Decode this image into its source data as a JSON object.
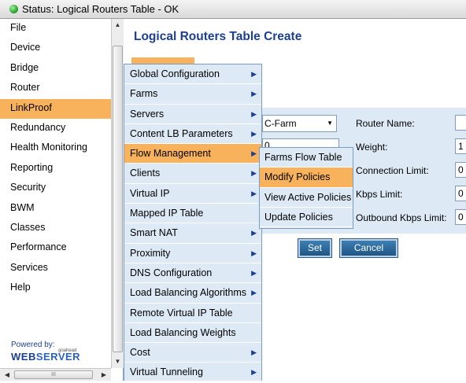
{
  "status": {
    "text": "Status:  Logical Routers Table   -  OK"
  },
  "nav": {
    "items": [
      {
        "label": "File"
      },
      {
        "label": "Device"
      },
      {
        "label": "Bridge"
      },
      {
        "label": "Router"
      },
      {
        "label": "LinkProof",
        "active": true
      },
      {
        "label": "Redundancy"
      },
      {
        "label": "Health Monitoring"
      },
      {
        "label": "Reporting"
      },
      {
        "label": "Security"
      },
      {
        "label": "BWM"
      },
      {
        "label": "Classes"
      },
      {
        "label": "Performance"
      },
      {
        "label": "Services"
      },
      {
        "label": "Help"
      }
    ],
    "powered_by": "Powered by:",
    "brand_small": "goahead",
    "brand_web": "WEB",
    "brand_server": "SERVER"
  },
  "main": {
    "title": "Logical Routers Table Create",
    "farm_select_value": "C-Farm",
    "left_weight_value": "0",
    "fields": {
      "router_name_label": "Router Name:",
      "weight_label": "Weight:",
      "weight_value": "1",
      "connection_limit_label": "Connection Limit:",
      "connection_limit_value": "0",
      "kbps_limit_label": "Kbps Limit:",
      "kbps_limit_value": "0",
      "outbound_kbps_limit_label": "Outbound Kbps Limit:",
      "outbound_kbps_limit_value": "0"
    },
    "set_button": "Set",
    "cancel_button": "Cancel"
  },
  "menu": {
    "items": [
      {
        "label": "Global Configuration",
        "submenu": true
      },
      {
        "label": "Farms",
        "submenu": true
      },
      {
        "label": "Servers",
        "submenu": true
      },
      {
        "label": "Content LB Parameters",
        "submenu": true
      },
      {
        "label": "Flow Management",
        "submenu": true,
        "active": true
      },
      {
        "label": "Clients",
        "submenu": true
      },
      {
        "label": "Virtual IP",
        "submenu": true
      },
      {
        "label": "Mapped IP Table",
        "submenu": false
      },
      {
        "label": "Smart NAT",
        "submenu": true
      },
      {
        "label": "Proximity",
        "submenu": true
      },
      {
        "label": "DNS Configuration",
        "submenu": true
      },
      {
        "label": "Load Balancing Algorithms",
        "submenu": true
      },
      {
        "label": "Remote Virtual IP Table",
        "submenu": false
      },
      {
        "label": "Load Balancing Weights",
        "submenu": false
      },
      {
        "label": "Cost",
        "submenu": true
      },
      {
        "label": "Virtual Tunneling",
        "submenu": true
      }
    ]
  },
  "submenu": {
    "items": [
      {
        "label": "Farms Flow Table"
      },
      {
        "label": "Modify Policies",
        "active": true
      },
      {
        "label": "View Active Policies"
      },
      {
        "label": "Update Policies"
      }
    ]
  },
  "colors": {
    "accent_orange": "#f7b25b",
    "title_blue": "#1c3f94",
    "panel_blue": "#dde9f5"
  }
}
